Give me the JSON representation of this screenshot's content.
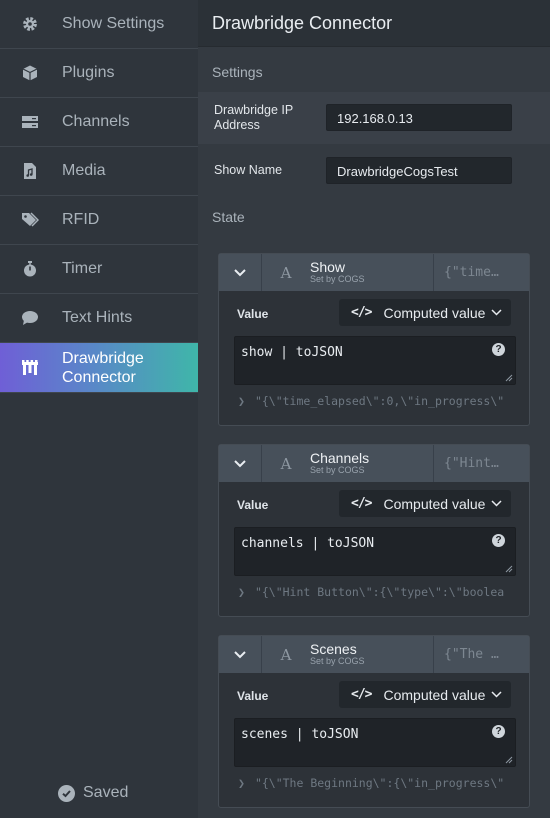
{
  "sidebar": {
    "items": [
      {
        "label": "Show Settings",
        "icon": "gear-icon"
      },
      {
        "label": "Plugins",
        "icon": "cube-icon"
      },
      {
        "label": "Channels",
        "icon": "server-icon"
      },
      {
        "label": "Media",
        "icon": "audio-file-icon"
      },
      {
        "label": "RFID",
        "icon": "tags-icon"
      },
      {
        "label": "Timer",
        "icon": "stopwatch-icon"
      },
      {
        "label": "Text Hints",
        "icon": "comment-icon"
      },
      {
        "label": "Drawbridge Connector",
        "label_line1": "Drawbridge",
        "label_line2": "Connector",
        "icon": "drawbridge-icon",
        "active": true
      }
    ],
    "status": "Saved"
  },
  "main": {
    "title": "Drawbridge Connector",
    "settings_heading": "Settings",
    "fields": [
      {
        "label_line1": "Drawbridge IP",
        "label_line2": "Address",
        "value": "192.168.0.13"
      },
      {
        "label": "Show Name",
        "value": "DrawbridgeCogsTest"
      }
    ],
    "state_heading": "State",
    "cards": [
      {
        "name": "Show",
        "subtitle": "Set by COGS",
        "preview": "{\"time…",
        "value_label": "Value",
        "mode": "Computed value",
        "expression": "show | toJSON",
        "result": "\"{\\\"time_elapsed\\\":0,\\\"in_progress\\\""
      },
      {
        "name": "Channels",
        "subtitle": "Set by COGS",
        "preview": "{\"Hint…",
        "value_label": "Value",
        "mode": "Computed value",
        "expression": "channels | toJSON",
        "result": "\"{\\\"Hint Button\\\":{\\\"type\\\":\\\"boolea"
      },
      {
        "name": "Scenes",
        "subtitle": "Set by COGS",
        "preview": "{\"The …",
        "value_label": "Value",
        "mode": "Computed value",
        "expression": "scenes | toJSON",
        "result": "\"{\\\"The Beginning\\\":{\\\"in_progress\\\""
      }
    ]
  },
  "colors": {
    "active_gradient_start": "#6f5fd6",
    "active_gradient_end": "#3fb6a9",
    "sidebar_bg": "#2f353c",
    "main_bg": "#343a41"
  }
}
